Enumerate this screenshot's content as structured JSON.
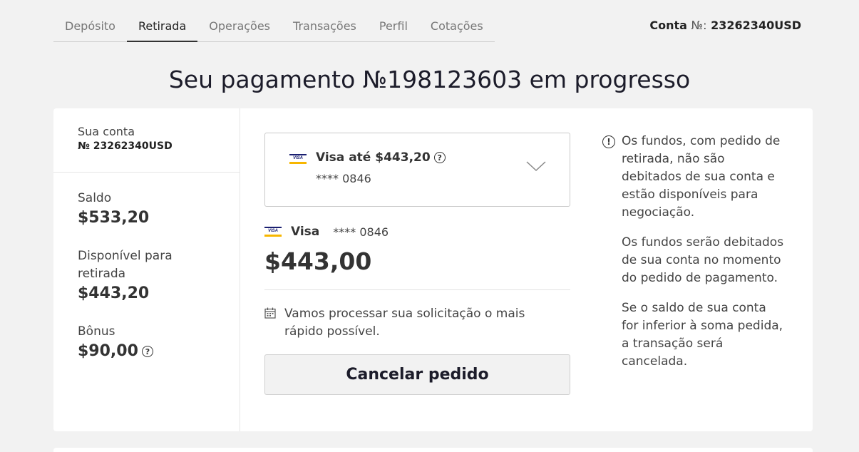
{
  "nav": {
    "tabs": [
      {
        "label": "Depósito",
        "active": false
      },
      {
        "label": "Retirada",
        "active": true
      },
      {
        "label": "Operações",
        "active": false
      },
      {
        "label": "Transações",
        "active": false
      },
      {
        "label": "Perfil",
        "active": false
      },
      {
        "label": "Cotações",
        "active": false
      }
    ],
    "account_label": "Conta",
    "account_sign": "№:",
    "account_number": "23262340USD"
  },
  "page_title": "Seu pagamento №198123603 em progresso",
  "summary": {
    "account_label": "Sua conta",
    "account_number": "№ 23262340USD",
    "balance_label": "Saldo",
    "balance_value": "$533,20",
    "available_label": "Disponível para retirada",
    "available_value": "$443,20",
    "bonus_label": "Bônus",
    "bonus_value": "$90,00"
  },
  "payment": {
    "selector_title_prefix": "Visa até ",
    "selector_title_amount": "$443,20",
    "selector_card_mask": "**** 0846",
    "card_name": "Visa",
    "card_mask": "**** 0846",
    "amount": "$443,00",
    "notice": "Vamos processar sua solicitação o mais rápido possível.",
    "cancel_label": "Cancelar pedido",
    "logo_text": "VISA"
  },
  "info": {
    "paragraphs": [
      "Os fundos, com pedido de retirada, não são debitados de sua conta e estão disponíveis para negociação.",
      "Os fundos serão debitados de sua conta no momento do pedido de pagamento.",
      "Se o saldo de sua conta for inferior à soma pedida, a transação será cancelada."
    ]
  },
  "colors": {
    "background": "#f2f2f2",
    "card": "#ffffff",
    "visa_blue": "#1a1f71",
    "visa_gold": "#f7b600"
  },
  "icons": {
    "help": "question-circle-icon",
    "info": "info-circle-icon",
    "calendar": "calendar-icon",
    "dropdown": "chevron-down-icon"
  }
}
